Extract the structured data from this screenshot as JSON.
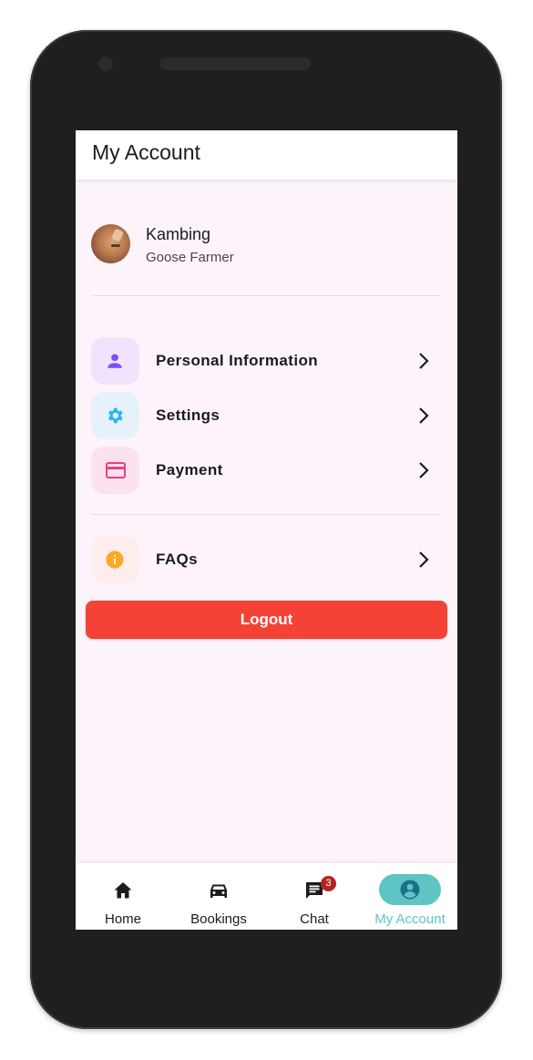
{
  "appbar": {
    "title": "My Account"
  },
  "profile": {
    "name": "Kambing",
    "role": "Goose Farmer"
  },
  "menu": [
    {
      "label": "Personal Information",
      "icon": "person-icon",
      "color": "#7c4dff",
      "bg": "#efe4fb"
    },
    {
      "label": "Settings",
      "icon": "gear-icon",
      "color": "#29b6f6",
      "bg": "#e7f1fb"
    },
    {
      "label": "Payment",
      "icon": "credit-card-icon",
      "color": "#ec407a",
      "bg": "#fbe2ee"
    },
    {
      "label": "FAQs",
      "icon": "info-icon",
      "color": "#ffa726",
      "bg": "#fdeeed"
    }
  ],
  "logout": {
    "label": "Logout",
    "color": "#f44336"
  },
  "navbar": {
    "items": [
      {
        "label": "Home",
        "icon": "home-icon"
      },
      {
        "label": "Bookings",
        "icon": "car-icon"
      },
      {
        "label": "Chat",
        "icon": "chat-icon",
        "badge": "3"
      },
      {
        "label": "My Account",
        "icon": "account-circle-icon",
        "active": true
      }
    ],
    "active_color": "#5ec4c4"
  }
}
